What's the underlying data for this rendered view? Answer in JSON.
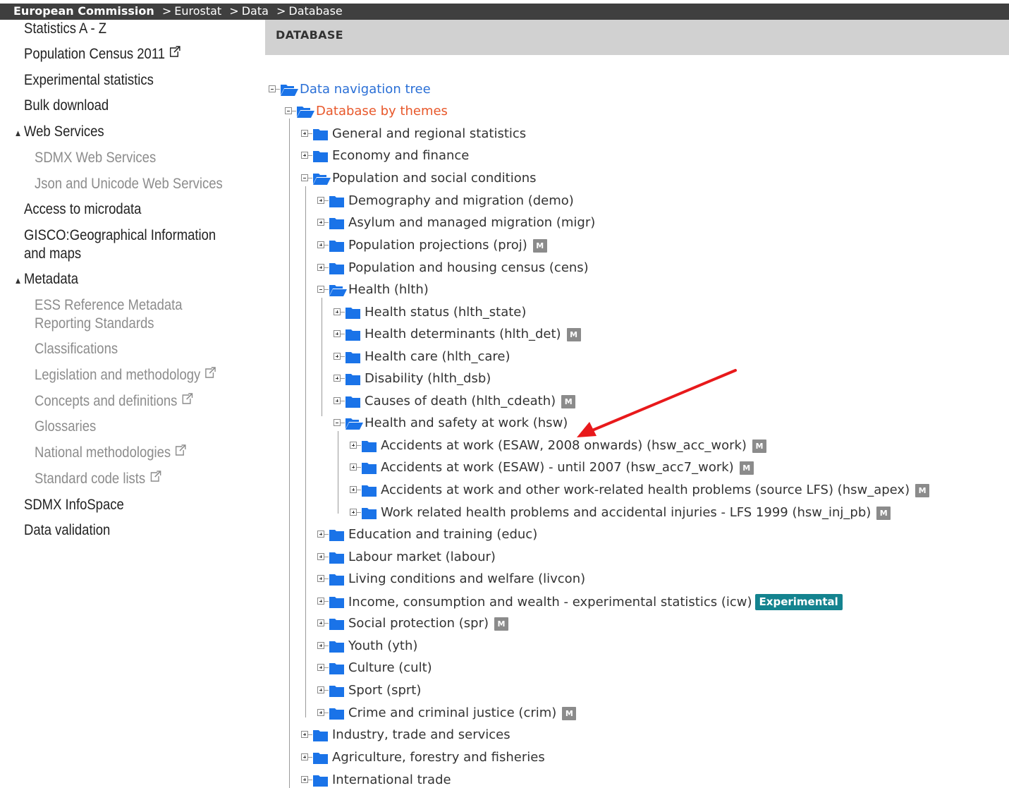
{
  "breadcrumb": [
    "European Commission",
    "Eurostat",
    "Data",
    "Database"
  ],
  "breadcrumb_separator": ">",
  "sidebar": {
    "items": [
      {
        "label": "Statistics A - Z",
        "type": "link",
        "external": false
      },
      {
        "label": "Population Census 2011",
        "type": "link",
        "external": true
      },
      {
        "label": "Experimental statistics",
        "type": "link",
        "external": false
      },
      {
        "label": "Bulk download",
        "type": "link",
        "external": false
      },
      {
        "label": "Web Services",
        "type": "section",
        "expanded": true
      },
      {
        "label": "SDMX Web Services",
        "type": "sublink",
        "external": false
      },
      {
        "label": "Json and Unicode Web Services",
        "type": "sublink",
        "external": false
      },
      {
        "label": "Access to microdata",
        "type": "link",
        "external": false
      },
      {
        "label": "GISCO:Geographical Information",
        "type": "link",
        "external": false
      },
      {
        "label": "and maps",
        "type": "link-cont",
        "external": false
      },
      {
        "label": "Metadata",
        "type": "section",
        "expanded": true
      },
      {
        "label": "ESS Reference Metadata",
        "type": "sublink",
        "external": false
      },
      {
        "label": "Reporting Standards",
        "type": "sublink-cont",
        "external": false
      },
      {
        "label": "Classifications",
        "type": "sublink",
        "external": false
      },
      {
        "label": "Legislation and methodology",
        "type": "sublink",
        "external": true
      },
      {
        "label": "Concepts and definitions",
        "type": "sublink",
        "external": true
      },
      {
        "label": "Glossaries",
        "type": "sublink",
        "external": false
      },
      {
        "label": "National methodologies",
        "type": "sublink",
        "external": true
      },
      {
        "label": "Standard code lists",
        "type": "sublink",
        "external": true
      },
      {
        "label": "SDMX InfoSpace",
        "type": "link",
        "external": false
      },
      {
        "label": "Data validation",
        "type": "link",
        "external": false
      }
    ]
  },
  "main": {
    "header": "DATABASE",
    "metadata_badge": "M",
    "experimental_badge": "Experimental",
    "tree": [
      {
        "label": "Data navigation tree",
        "level": 0,
        "expanded": true,
        "color": "blue",
        "metadata": false
      },
      {
        "label": "Database by themes",
        "level": 1,
        "expanded": true,
        "color": "orange",
        "metadata": false
      },
      {
        "label": "General and regional statistics",
        "level": 2,
        "expanded": false,
        "metadata": false
      },
      {
        "label": "Economy and finance",
        "level": 2,
        "expanded": false,
        "metadata": false
      },
      {
        "label": "Population and social conditions",
        "level": 2,
        "expanded": true,
        "metadata": false
      },
      {
        "label": "Demography and migration (demo)",
        "level": 3,
        "expanded": false,
        "metadata": false
      },
      {
        "label": "Asylum and managed migration (migr)",
        "level": 3,
        "expanded": false,
        "metadata": false
      },
      {
        "label": "Population projections (proj)",
        "level": 3,
        "expanded": false,
        "metadata": true
      },
      {
        "label": "Population and housing census (cens)",
        "level": 3,
        "expanded": false,
        "metadata": false
      },
      {
        "label": "Health (hlth)",
        "level": 3,
        "expanded": true,
        "metadata": false
      },
      {
        "label": "Health status (hlth_state)",
        "level": 4,
        "expanded": false,
        "metadata": false
      },
      {
        "label": "Health determinants (hlth_det)",
        "level": 4,
        "expanded": false,
        "metadata": true
      },
      {
        "label": "Health care (hlth_care)",
        "level": 4,
        "expanded": false,
        "metadata": false
      },
      {
        "label": "Disability (hlth_dsb)",
        "level": 4,
        "expanded": false,
        "metadata": false
      },
      {
        "label": "Causes of death (hlth_cdeath)",
        "level": 4,
        "expanded": false,
        "metadata": true
      },
      {
        "label": "Health and safety at work (hsw)",
        "level": 4,
        "expanded": true,
        "metadata": false
      },
      {
        "label": "Accidents at work (ESAW, 2008 onwards) (hsw_acc_work)",
        "level": 5,
        "expanded": false,
        "metadata": true
      },
      {
        "label": "Accidents at work (ESAW) - until 2007 (hsw_acc7_work)",
        "level": 5,
        "expanded": false,
        "metadata": true
      },
      {
        "label": "Accidents at work and other work-related health problems (source LFS) (hsw_apex)",
        "level": 5,
        "expanded": false,
        "metadata": true
      },
      {
        "label": "Work related health problems and accidental injuries - LFS 1999 (hsw_inj_pb)",
        "level": 5,
        "expanded": false,
        "metadata": true
      },
      {
        "label": "Education and training (educ)",
        "level": 3,
        "expanded": false,
        "metadata": false
      },
      {
        "label": "Labour market (labour)",
        "level": 3,
        "expanded": false,
        "metadata": false
      },
      {
        "label": "Living conditions and welfare (livcon)",
        "level": 3,
        "expanded": false,
        "metadata": false
      },
      {
        "label": "Income, consumption and wealth - experimental statistics (icw)",
        "level": 3,
        "expanded": false,
        "metadata": false,
        "experimental": true
      },
      {
        "label": "Social protection (spr)",
        "level": 3,
        "expanded": false,
        "metadata": true
      },
      {
        "label": "Youth (yth)",
        "level": 3,
        "expanded": false,
        "metadata": false
      },
      {
        "label": "Culture (cult)",
        "level": 3,
        "expanded": false,
        "metadata": false
      },
      {
        "label": "Sport (sprt)",
        "level": 3,
        "expanded": false,
        "metadata": false
      },
      {
        "label": "Crime and criminal justice (crim)",
        "level": 3,
        "expanded": false,
        "metadata": true
      },
      {
        "label": "Industry, trade and services",
        "level": 2,
        "expanded": false,
        "metadata": false
      },
      {
        "label": "Agriculture, forestry and fisheries",
        "level": 2,
        "expanded": false,
        "metadata": false
      },
      {
        "label": "International trade",
        "level": 2,
        "expanded": false,
        "metadata": false
      }
    ]
  },
  "colors": {
    "topbar": "#3f3f3f",
    "header_band": "#d1d1d1",
    "folder": "#1a73e8",
    "link_blue": "#2a6fd6",
    "active_orange": "#e8582b",
    "badge_gray": "#8b8b8b",
    "experimental_teal": "#14838f",
    "annotation_arrow": "#e8191b"
  },
  "icons": {
    "folder_closed": "folder-icon",
    "folder_open": "folder-open-icon",
    "external_link": "external-link-icon",
    "expand": "plus-box-icon",
    "collapse": "minus-box-icon",
    "section_toggle": "triangle-up-icon"
  }
}
